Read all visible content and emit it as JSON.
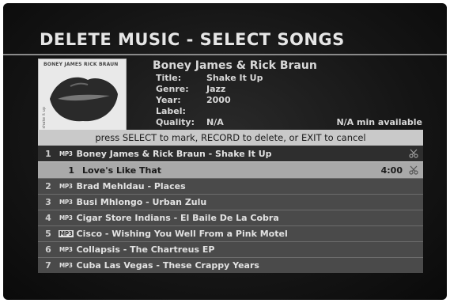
{
  "screen": {
    "title": "DELETE MUSIC - SELECT SONGS"
  },
  "album": {
    "cover_label": "BONEY JAMES RICK BRAUN",
    "cover_side": "shake it up",
    "artist": "Boney James & Rick Braun",
    "fields": [
      {
        "label": "Title:",
        "value": "Shake It Up"
      },
      {
        "label": "Genre:",
        "value": "Jazz"
      },
      {
        "label": "Year:",
        "value": "2000"
      },
      {
        "label": "Label:",
        "value": ""
      },
      {
        "label": "Quality:",
        "value": "N/A"
      }
    ],
    "available": "N/A min available"
  },
  "instructions": "press SELECT to mark, RECORD to delete, or EXIT to cancel",
  "list": {
    "album_row": {
      "num": "1",
      "badge": "MP3",
      "name": "Boney James & Rick Braun - Shake It Up"
    },
    "track_row": {
      "num": "1",
      "name": "Love's Like That",
      "duration": "4:00"
    },
    "items": [
      {
        "num": "2",
        "badge": "MP3",
        "name": "Brad Mehldau - Places"
      },
      {
        "num": "3",
        "badge": "MP3",
        "name": "Busi Mhlongo - Urban Zulu"
      },
      {
        "num": "4",
        "badge": "MP3",
        "name": "Cigar Store Indians - El Baile De La Cobra"
      },
      {
        "num": "5",
        "badge": "MP3",
        "name": "Cisco - Wishing You Well From a Pink Motel"
      },
      {
        "num": "6",
        "badge": "MP3",
        "name": "Collapsis - The Chartreus EP"
      },
      {
        "num": "7",
        "badge": "MP3",
        "name": "Cuba Las Vegas - These Crappy Years"
      }
    ]
  },
  "icons": {
    "mark": "scissors-icon"
  },
  "colors": {
    "background": "#151515",
    "instruction_bar": "#c9c9c9",
    "selected_track": "#a9a9a9",
    "list_row": "#4a4a4a"
  }
}
